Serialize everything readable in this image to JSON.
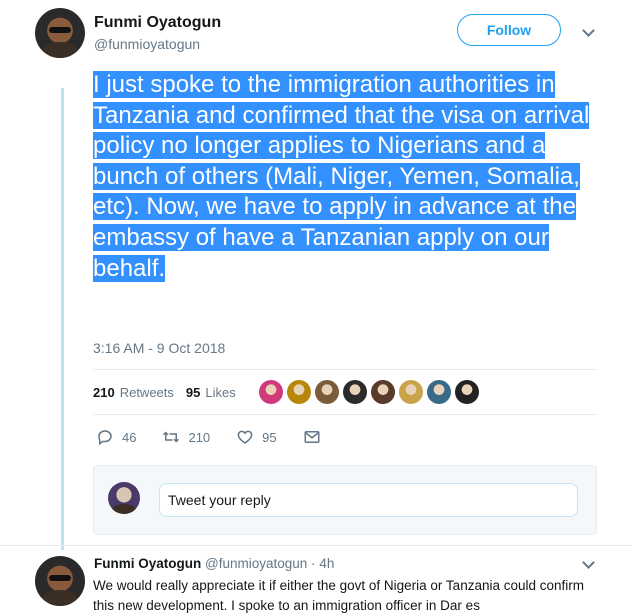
{
  "tweet": {
    "author_name": "Funmi Oyatogun",
    "author_handle": "@funmioyatogun",
    "follow_label": "Follow",
    "text": "I just spoke to the immigration authorities in Tanzania and confirmed that the visa on arrival policy no longer applies to Nigerians and a bunch of others (Mali, Niger, Yemen, Somalia, etc). Now, we have to apply in advance at the embassy of have a Tanzanian apply on our behalf.",
    "timestamp": "3:16 AM - 9 Oct 2018",
    "retweets_count": "210",
    "retweets_label": "Retweets",
    "likes_count": "95",
    "likes_label": "Likes",
    "likers": [
      "#d13a7a",
      "#b8860b",
      "#7a5c3a",
      "#2b2b2b",
      "#5a3a2a",
      "#c9a44a",
      "#3a6a8a",
      "#222222"
    ],
    "actions": {
      "reply_count": "46",
      "retweet_count": "210",
      "like_count": "95"
    }
  },
  "reply_box": {
    "placeholder": "Tweet your reply"
  },
  "reply": {
    "author_name": "Funmi Oyatogun",
    "author_handle": "@funmioyatogun",
    "time": "4h",
    "text": "We would really appreciate it if either the govt of Nigeria or Tanzania could confirm this new development. I spoke to an immigration officer in Dar es"
  }
}
